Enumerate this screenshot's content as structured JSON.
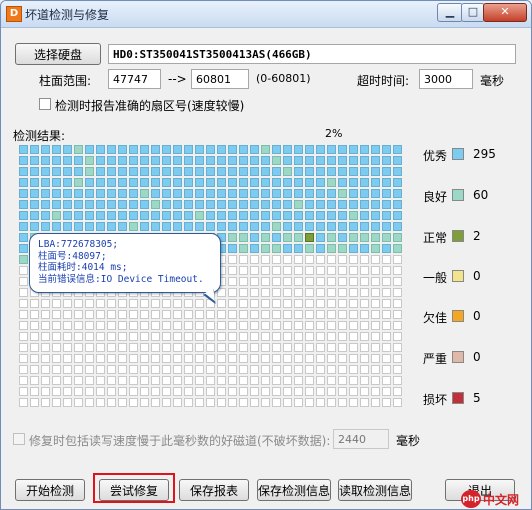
{
  "window": {
    "title": "坏道检测与修复",
    "app_icon": "D"
  },
  "top": {
    "select_disk_label": "选择硬盘",
    "disk_info": "HD0:ST350041ST3500413AS(466GB)",
    "cylinder_range_label": "柱面范围:",
    "cylinder_start": "47747",
    "arrow": "-->",
    "cylinder_end": "60801",
    "cylinder_hint": "(0-60801)",
    "timeout_label": "超时时间:",
    "timeout_value": "3000",
    "timeout_unit": "毫秒",
    "report_sector_label": "检测时报告准确的扇区号(速度较慢)"
  },
  "results": {
    "label": "检测结果:",
    "progress_text": "2%",
    "progress_percent": 2
  },
  "grid": {
    "cols": 35,
    "rows": 24,
    "checked_count": 357
  },
  "tooltip": {
    "lba": "LBA:772678305;",
    "cylinder": "柱面号:48097;",
    "time": "柱面耗时:4014 ms;",
    "error": "当前错误信息:IO Device Timeout."
  },
  "legend": [
    {
      "name": "优秀",
      "count": "295",
      "color": "#7ccbf0"
    },
    {
      "name": "良好",
      "count": "60",
      "color": "#9cd8c8"
    },
    {
      "name": "正常",
      "count": "2",
      "color": "#7e9e3c"
    },
    {
      "name": "一般",
      "count": "0",
      "color": "#f2e48a"
    },
    {
      "name": "欠佳",
      "count": "0",
      "color": "#f5a623"
    },
    {
      "name": "严重",
      "count": "0",
      "color": "#e0b8a8"
    },
    {
      "name": "损坏",
      "count": "5",
      "color": "#c0303a"
    }
  ],
  "repair": {
    "label": "修复时包括读写速度慢于此毫秒数的好磁道(不破坏数据):",
    "value": "2440",
    "unit": "毫秒"
  },
  "buttons": {
    "start": "开始检测",
    "try_repair": "尝试修复",
    "save_report": "保存报表",
    "save_info": "保存检测信息",
    "read_info": "读取检测信息",
    "exit": "退出"
  },
  "watermark": {
    "text": "中文网",
    "badge": "php"
  }
}
